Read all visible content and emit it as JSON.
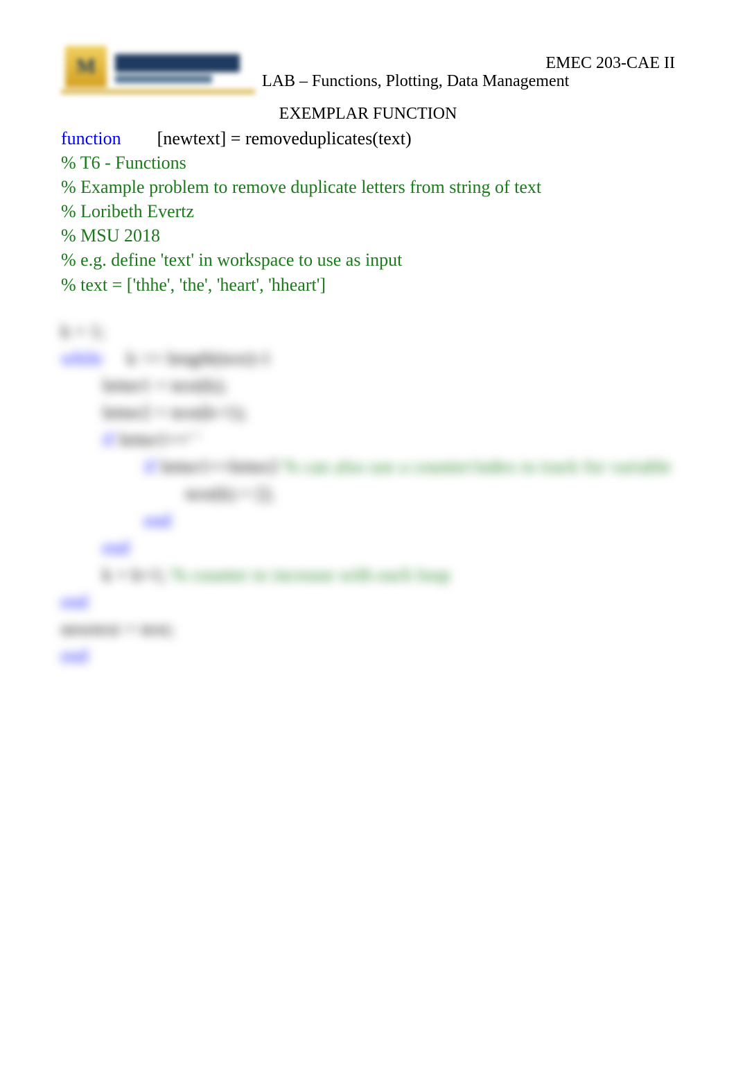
{
  "header": {
    "course_id": "EMEC 203-CAE II",
    "lab_title": "LAB – Functions, Plotting, Data Management"
  },
  "section_title": "EXEMPLAR FUNCTION",
  "code": {
    "func_kw": "function",
    "func_sig": "        [newtext] = removeduplicates(text)",
    "c1": "% T6 - Functions",
    "c2": "% Example problem to remove duplicate letters from string of text",
    "c3": "% Loribeth Evertz",
    "c4": "% MSU 2018",
    "c5": "% e.g. define 'text' in workspace to use as input",
    "c6": "% text = ['thhe', 'the', 'heart', 'hheart']"
  },
  "blurred": {
    "l1_a": "k = 1;",
    "l2_kw": "while",
    "l2_b": "     k <= length(text)-1",
    "l3": "letter1 = text(k);",
    "l4": "letter2 = text(k+1);",
    "l5_kw": "if",
    "l5_b": " letter1==' '",
    "l6_kw": "if",
    "l6_b": " letter1==letter2 ",
    "l6_c": "% can also use a counter/index to track for variable",
    "l7": "text(k) = [];",
    "l8_kw": "end",
    "l9_kw": "end",
    "l10_a": "k = k+1; ",
    "l10_c": "% counter to increase with each loop",
    "l11_kw": "end",
    "l12": "newtext = text;",
    "l13_kw": "end"
  }
}
